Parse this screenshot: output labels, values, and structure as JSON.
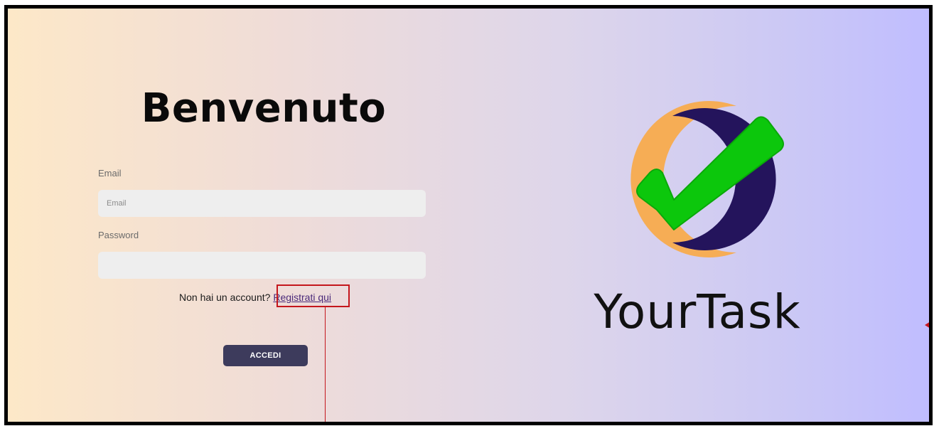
{
  "login": {
    "title": "Benvenuto",
    "email_label": "Email",
    "email_placeholder": "Email",
    "password_label": "Password",
    "password_placeholder": "",
    "register_prompt": "Non hai un account?",
    "register_link": "Registrati qui",
    "submit_label": "ACCEDI"
  },
  "branding": {
    "name": "YourTask",
    "logo_icon": "checkmark-circle-logo",
    "colors": {
      "ring_orange": "#f6ad55",
      "ring_navy": "#24145c",
      "check_green": "#0cc70c",
      "button": "#3d3b5c",
      "annotation": "#c4161c"
    }
  }
}
